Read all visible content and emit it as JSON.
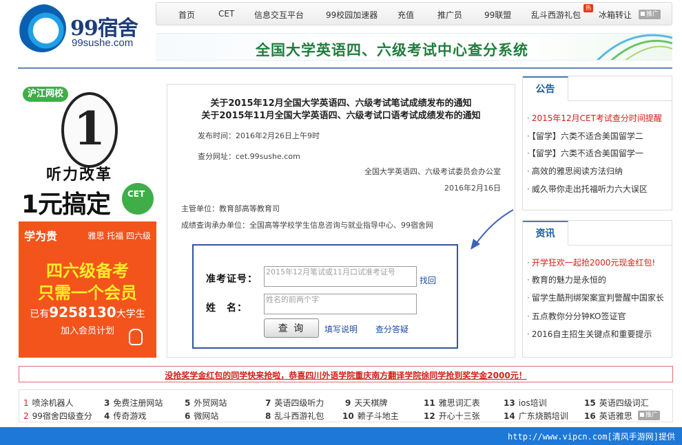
{
  "logo": {
    "name": "99宿舍",
    "domain": "99sushe.com"
  },
  "nav": {
    "items": [
      "首页",
      "CET",
      "信息交互平台",
      "99校园加速器",
      "充值",
      "推广员",
      "99联盟",
      "乱斗西游礼包",
      "冰箱转让"
    ],
    "hot_badge": "热",
    "ad_tag": "推广"
  },
  "banner": {
    "title": "全国大学英语四、六级考试中心查分系统"
  },
  "left_ad": {
    "brand": "沪江网校",
    "coin_digit": "1",
    "headline1": "听力改革",
    "headline2": "1元搞定",
    "badge_text": "CET",
    "lower_brand": "学为贵",
    "lower_tags": "雅思 托福 四六级",
    "line1": "四六级备考",
    "line2": "只需一个会员",
    "count_prefix": "已有",
    "count_number": "9258130",
    "count_suffix": "大学生",
    "join_text": "加入会员计划"
  },
  "notice": {
    "title1": "关于2015年12月全国大学英语四、六级考试笔试成绩发布的通知",
    "title2": "关于2015年11月全国大学英语四、六级考试口语考试成绩发布的通知",
    "publish_time": "发布时间：2016年2月26日上午9时",
    "query_url": "查分网址：cet.99sushe.com",
    "issuer": "全国大学英语四、六级考试委员会办公室",
    "issue_date": "2016年2月16日",
    "authority": "主管单位：教育部高等教育司",
    "operator": "成绩查询承办单位：全国高等学校学生信息咨询与就业指导中心、99宿舍网"
  },
  "query": {
    "id_label": "准考证号：",
    "id_placeholder": "2015年12月笔试或11月口试准考证号",
    "find_label": "找回",
    "name_label": "姓　名：",
    "name_placeholder": "姓名的前两个字",
    "submit_label": "查 询",
    "help_label": "填写说明",
    "faq_label": "查分答疑"
  },
  "announcements": {
    "tab": "公告",
    "items": [
      {
        "text": "2015年12月CET考试查分时间提醒",
        "red": true
      },
      {
        "text": "【留学】六类不适合美国留学二",
        "red": false
      },
      {
        "text": "【留学】六类不适合美国留学一",
        "red": false
      },
      {
        "text": "高效的雅思阅读方法归纳",
        "red": false
      },
      {
        "text": "威久带你走出托福听力六大误区",
        "red": false
      }
    ]
  },
  "news": {
    "tab": "资讯",
    "items": [
      {
        "text": "开学狂欢一起抢2000元现金红包!",
        "red": true
      },
      {
        "text": "教育的魅力是永恒的",
        "red": false
      },
      {
        "text": "留学生酷刑绑架案宣判警醒中国家长",
        "red": false
      },
      {
        "text": "五点教你分分钟KO签证官",
        "red": false
      },
      {
        "text": "2016自主招生关键点和重要提示",
        "red": false
      }
    ]
  },
  "ticker": "没抢奖学金红包的同学快来抢啦，恭喜四川外语学院重庆南方翻译学院徐同学抢到奖学金2000元！",
  "links": [
    {
      "num": "1",
      "text": "喷涂机器人"
    },
    {
      "num": "3",
      "text": "免费注册网站"
    },
    {
      "num": "5",
      "text": "外贸网站"
    },
    {
      "num": "7",
      "text": "英语四级听力"
    },
    {
      "num": "9",
      "text": "天天棋牌"
    },
    {
      "num": "11",
      "text": "雅思词汇表"
    },
    {
      "num": "13",
      "text": "ios培训"
    },
    {
      "num": "15",
      "text": "英语四级词汇"
    },
    {
      "num": "2",
      "text": "99宿舍四级查分"
    },
    {
      "num": "4",
      "text": "传奇游戏"
    },
    {
      "num": "6",
      "text": "微网站"
    },
    {
      "num": "8",
      "text": "乱斗西游礼包"
    },
    {
      "num": "10",
      "text": "赖子斗地主"
    },
    {
      "num": "12",
      "text": "开心十三张"
    },
    {
      "num": "14",
      "text": "广东烧鹅培训"
    },
    {
      "num": "16",
      "text": "英语雅思"
    }
  ],
  "footer": "http://www.vipcn.com[清风手游网]提供"
}
